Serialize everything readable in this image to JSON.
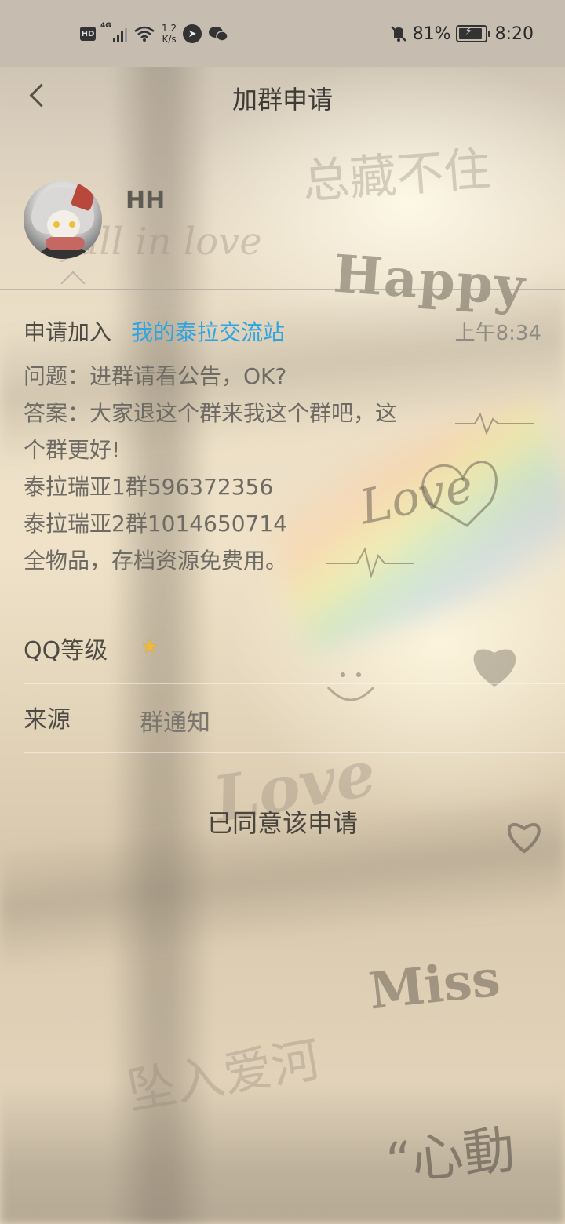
{
  "status_bar": {
    "hd": "HD",
    "network": "4G",
    "speed_value": "1.2",
    "speed_unit": "K/s",
    "battery": "81%",
    "time": "8:20"
  },
  "header": {
    "title": "加群申请",
    "back_icon": "chevron-left-icon"
  },
  "profile": {
    "nickname": "HH"
  },
  "request": {
    "label": "申请加入",
    "group": "我的泰拉交流站",
    "time": "上午8:34",
    "message_lines": [
      "问题：进群请看公告，OK?",
      "答案：大家退这个群来我这个群吧，这",
      "个群更好!",
      "泰拉瑞亚1群596372356",
      "泰拉瑞亚2群1014650714",
      "全物品，存档资源免费用。"
    ]
  },
  "details": {
    "level_label": "QQ等级",
    "level_icon": "star-icon",
    "source_label": "来源",
    "source_value": "群通知"
  },
  "status": {
    "text": "已同意该申请"
  },
  "wallpaper": {
    "texts": [
      "总藏不住",
      "fall in love",
      "Happy",
      "Love",
      "Love",
      "Miss",
      "坠入爱河",
      "“心動"
    ]
  },
  "colors": {
    "link": "#2fa4e0",
    "status_bar_bg": "#c6bdb0"
  }
}
